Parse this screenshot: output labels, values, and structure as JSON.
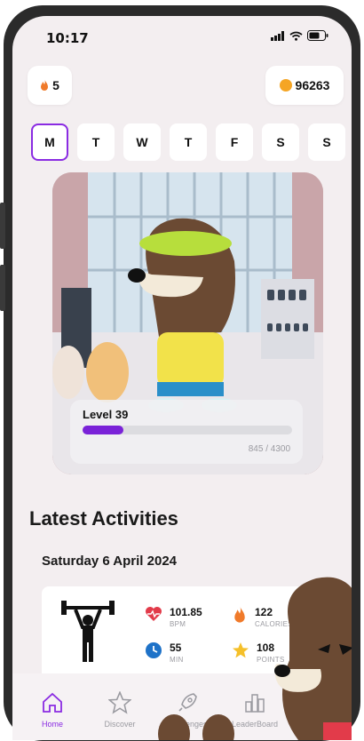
{
  "status_bar": {
    "time": "10:17"
  },
  "streak": {
    "icon": "flame-icon",
    "count": "5"
  },
  "coins": {
    "icon": "coin-icon",
    "amount": "96263"
  },
  "week_days": [
    "M",
    "T",
    "W",
    "T",
    "F",
    "S",
    "S"
  ],
  "selected_day_index": 0,
  "level": {
    "label": "Level 39",
    "xp_text": "845 / 4300",
    "progress_fraction": 0.196
  },
  "latest": {
    "heading": "Latest Activities",
    "date": "Saturday 6 April 2024"
  },
  "activity": {
    "icon": "weightlifting-icon",
    "stats": [
      {
        "icon": "heart-rate-icon",
        "value": "101.85",
        "unit": "BPM"
      },
      {
        "icon": "flame-icon",
        "value": "122",
        "unit": "CALORIES"
      },
      {
        "icon": "clock-icon",
        "value": "55",
        "unit": "MIN"
      },
      {
        "icon": "star-icon",
        "value": "108",
        "unit": "POINTS"
      }
    ]
  },
  "nav": {
    "items": [
      {
        "label": "Home",
        "icon": "home-icon"
      },
      {
        "label": "Discover",
        "icon": "star-outline-icon"
      },
      {
        "label": "Challenges",
        "icon": "rocket-icon"
      },
      {
        "label": "LeaderBoard",
        "icon": "bar-chart-icon"
      }
    ],
    "active_index": 0
  },
  "colors": {
    "accent": "#8a2be2",
    "progress": "#7a22d8",
    "coin": "#f5a524",
    "flame": "#f07a2a",
    "heart": "#e23b4a",
    "clock": "#1e72c8",
    "star": "#f5c02a"
  }
}
